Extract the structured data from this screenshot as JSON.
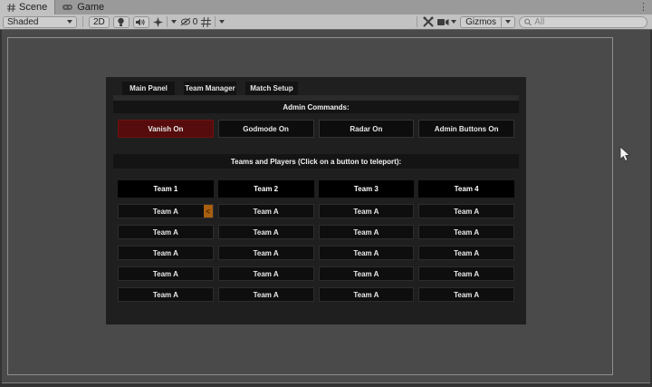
{
  "editor": {
    "tab_bar": {
      "scene_tab": "Scene",
      "game_tab": "Game",
      "menu_icon": "⋮"
    },
    "toolbar": {
      "draw_mode": "Shaded",
      "toggle_2d": "2D",
      "hidden_count": "0",
      "gizmos": "Gizmos",
      "search_placeholder": "All"
    },
    "colors": {
      "tabbar_bg": "#9a9a9a",
      "toolbar_bg": "#c2c2c2",
      "scene_bg": "#4a4a4a"
    }
  },
  "game_ui": {
    "tabs": [
      "Main Panel",
      "Team Manager",
      "Match Setup"
    ],
    "admin_header": "Admin Commands:",
    "admin_buttons": [
      "Vanish On",
      "Godmode On",
      "Radar On",
      "Admin Buttons On"
    ],
    "teams_header": "Teams and Players (Click on a button to teleport):",
    "selection_marker": "<",
    "columns": [
      {
        "name": "Team 1",
        "players": [
          "Team A",
          "Team A",
          "Team A",
          "Team A",
          "Team A"
        ]
      },
      {
        "name": "Team 2",
        "players": [
          "Team A",
          "Team A",
          "Team A",
          "Team A",
          "Team A"
        ]
      },
      {
        "name": "Team 3",
        "players": [
          "Team A",
          "Team A",
          "Team A",
          "Team A",
          "Team A"
        ]
      },
      {
        "name": "Team 4",
        "players": [
          "Team A",
          "Team A",
          "Team A",
          "Team A",
          "Team A"
        ]
      }
    ],
    "colors": {
      "active_admin_button": "#560c0c",
      "selection_marker_bg": "#a85f10",
      "panel_bg": "#1f1f1f"
    }
  }
}
